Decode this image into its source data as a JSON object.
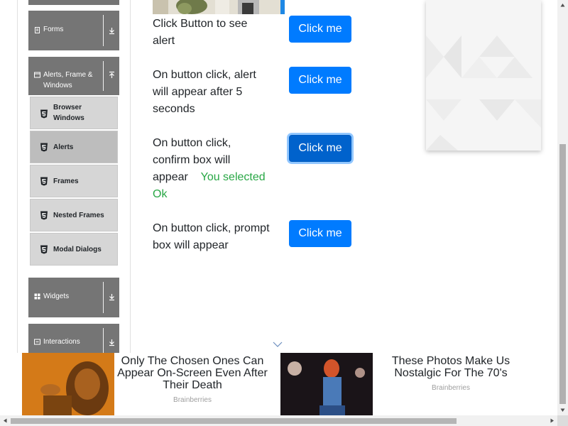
{
  "sidebar": {
    "groups": [
      {
        "label": "Forms",
        "icon": "form-icon",
        "expanded": false
      },
      {
        "label_line1": "Alerts, Frame &",
        "label_line2": "Windows",
        "icon": "window-icon",
        "expanded": true
      },
      {
        "label": "Widgets",
        "icon": "grid-icon",
        "expanded": false
      },
      {
        "label": "Interactions",
        "icon": "interactions-icon",
        "expanded": false
      }
    ],
    "items": [
      {
        "label_line1": "Browser",
        "label_line2": "Windows",
        "active": false
      },
      {
        "label": "Alerts",
        "active": true
      },
      {
        "label": "Frames",
        "active": false
      },
      {
        "label": "Nested Frames",
        "active": false
      },
      {
        "label": "Modal Dialogs",
        "active": false
      }
    ],
    "group_color": "#757575"
  },
  "alerts": {
    "row1": {
      "text": "Click Button to see alert",
      "button": "Click me"
    },
    "row2": {
      "text": "On button click, alert will appear after 5 seconds",
      "button": "Click me"
    },
    "row3": {
      "text": "On button click, confirm box will appear",
      "result": "You selected Ok",
      "button": "Click me"
    },
    "row4": {
      "text": "On button click, prompt box will appear",
      "button": "Click me"
    },
    "button_color": "#007bff",
    "result_color": "#28a745"
  },
  "ads": [
    {
      "title": "Only The Chosen Ones Can Appear On-Screen Even After Their Death",
      "source": "Brainberries"
    },
    {
      "title": "These Photos Make Us Nostalgic For The 70's",
      "source": "Brainberries"
    }
  ]
}
